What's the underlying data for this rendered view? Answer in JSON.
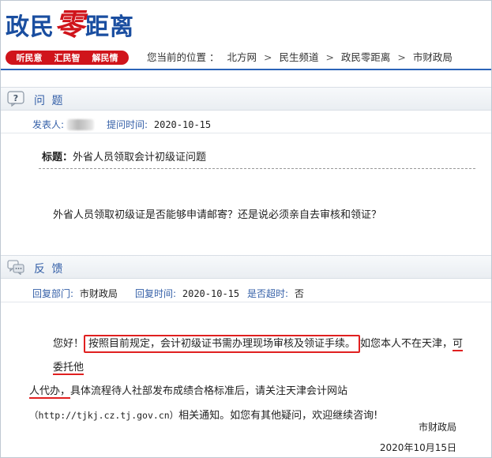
{
  "header": {
    "logo_part1": "政民",
    "logo_zero": "零",
    "logo_part2": "距离",
    "slogans": [
      "听民意",
      "汇民智",
      "解民情"
    ],
    "location_label": "您当前的位置 ：",
    "breadcrumb": [
      "北方网",
      "民生频道",
      "政民零距离",
      "市财政局"
    ],
    "breadcrumb_sep": ">"
  },
  "colors": {
    "brand_blue": "#1a4ea0",
    "brand_red": "#d0141b",
    "label_blue": "#3560a8",
    "highlight_red": "#e02020"
  },
  "question": {
    "section_title": "问 题",
    "section_icon": "question-icon",
    "poster_label": "发表人:",
    "time_label": "提问时间:",
    "time_value": "2020-10-15",
    "title_label": "标题：",
    "title_value": "外省人员领取会计初级证问题",
    "body": "外省人员领取初级证是否能够申请邮寄？还是说必须亲自去审核和领证？"
  },
  "feedback": {
    "section_title": "反 馈",
    "section_icon": "chat-bubbles-icon",
    "dept_label": "回复部门:",
    "dept_value": "市财政局",
    "time_label": "回复时间:",
    "time_value": "2020-10-15",
    "overdue_label": "是否超时:",
    "overdue_value": "否",
    "greeting": "您好！",
    "highlight_text": "按照目前规定，会计初级证书需办理现场审核及领证手续。",
    "text_after_highlight": "如您本人不在天津，",
    "underlined_1": "可委托他",
    "underlined_2": "人代办，",
    "text_cont": "具体流程待人社部发布成绩合格标准后，请关注天津会计网站",
    "url": "（http://tjkj.cz.tj.gov.cn）",
    "text_end": "相关通知。如您有其他疑问，欢迎继续咨询!",
    "signature": "市财政局",
    "date": "2020年10月15日"
  }
}
